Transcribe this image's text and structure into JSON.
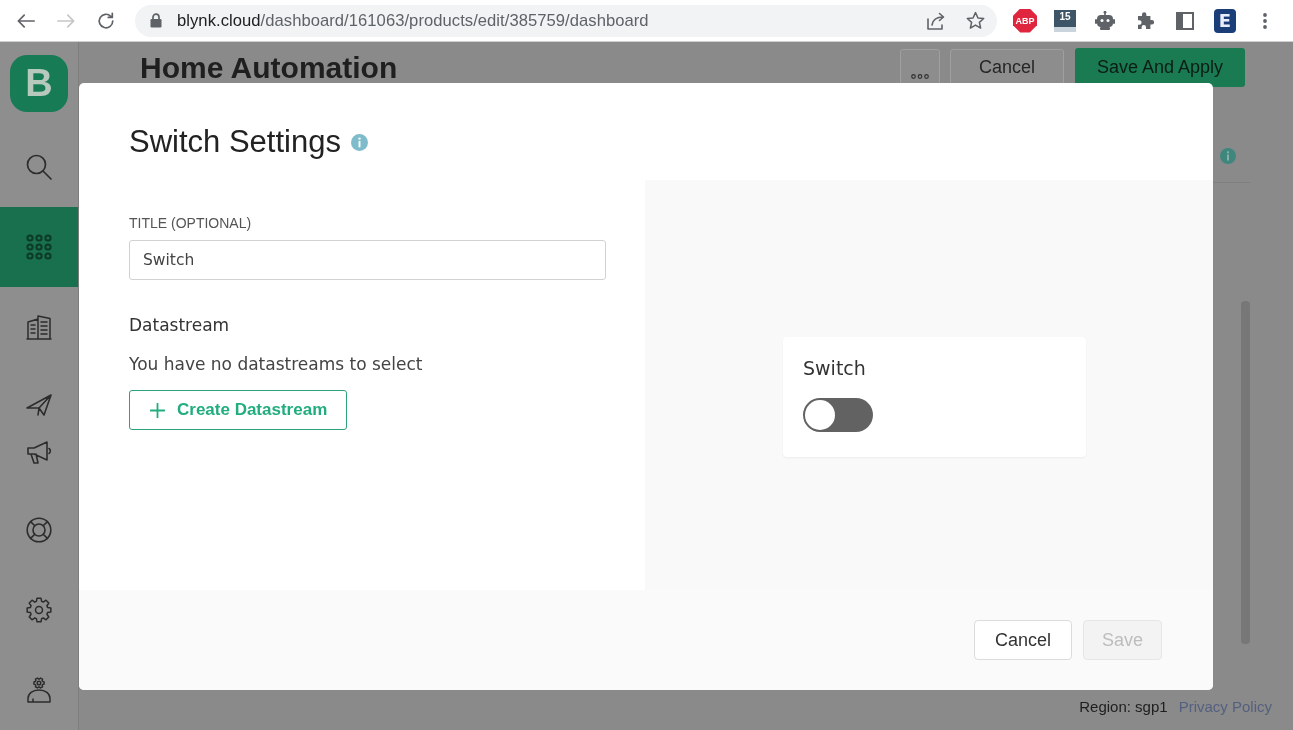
{
  "browser": {
    "nav": [
      {
        "kind": "back",
        "disabled": false
      },
      {
        "kind": "forward",
        "disabled": true
      },
      {
        "kind": "reload",
        "disabled": false
      }
    ],
    "url": {
      "host": "blynk.cloud",
      "path": "/dashboard/161063/products/edit/385759/dashboard"
    },
    "url_actions": [
      {
        "kind": "share"
      },
      {
        "kind": "bookmark"
      }
    ],
    "extensions": [
      {
        "kind": "adblock",
        "label": "ABP"
      },
      {
        "kind": "calendar",
        "label": "15"
      },
      {
        "kind": "robot"
      },
      {
        "kind": "puzzle"
      },
      {
        "kind": "sidepanel"
      },
      {
        "kind": "letter",
        "label": "E"
      },
      {
        "kind": "menu"
      }
    ]
  },
  "sidebar": {
    "logo": "B",
    "items": [
      {
        "kind": "search",
        "selected": false
      },
      {
        "kind": "dashboard",
        "selected": true
      },
      {
        "kind": "buildings",
        "selected": false
      },
      {
        "kind": "send",
        "selected": false
      },
      {
        "kind": "announce",
        "selected": false
      },
      {
        "kind": "help",
        "selected": false
      },
      {
        "kind": "settings",
        "selected": false
      },
      {
        "kind": "profile",
        "selected": false
      }
    ]
  },
  "page": {
    "title": "Home Automation",
    "buttons": [
      {
        "kind": "more"
      },
      {
        "kind": "secondary",
        "label": "Cancel"
      },
      {
        "kind": "primary",
        "label": "Save And Apply"
      }
    ],
    "footer": {
      "region": "Region: sgp1",
      "link": "Privacy Policy"
    }
  },
  "modal": {
    "title": "Switch Settings",
    "field": {
      "label": "TITLE (OPTIONAL)",
      "value": "Switch"
    },
    "datastream": {
      "heading": "Datastream",
      "message": "You have no datastreams to select",
      "button": "Create Datastream"
    },
    "preview": {
      "title": "Switch",
      "toggle": {
        "on": false
      }
    },
    "buttons": [
      {
        "label": "Cancel",
        "disabled": false
      },
      {
        "label": "Save",
        "disabled": true
      }
    ]
  }
}
